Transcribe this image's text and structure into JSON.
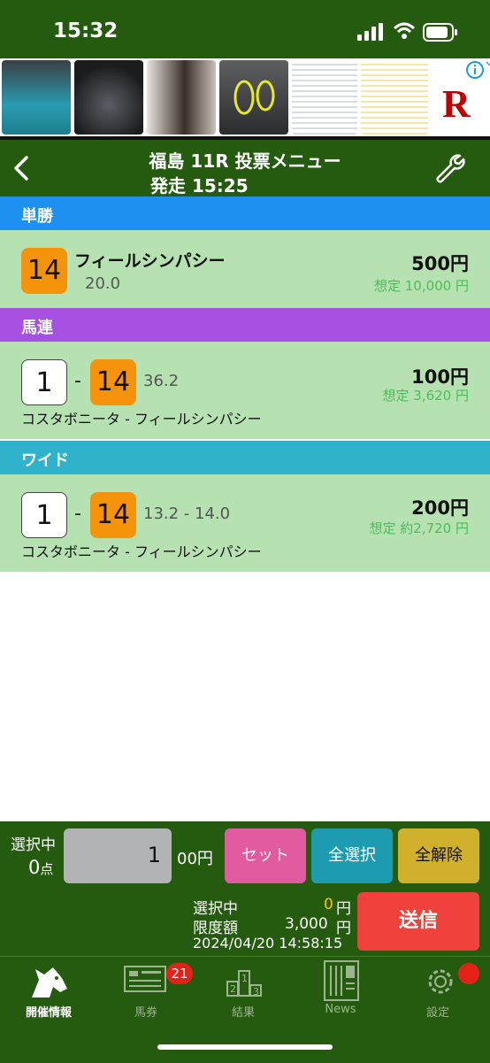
{
  "status": {
    "time": "15:32"
  },
  "ad": {
    "brand_letter": "R"
  },
  "header": {
    "title": "福島 11R 投票メニュー",
    "start": "発走 15:25"
  },
  "sections": [
    {
      "type": "単勝",
      "color": "#1e90f0",
      "bet": {
        "num": "14",
        "horse": "フィールシンパシー",
        "odds": "20.0",
        "amount": "500円",
        "estimate": "想定 10,000 円"
      }
    },
    {
      "type": "馬連",
      "color": "#a550e0",
      "bet": {
        "num1": "1",
        "num2": "14",
        "odds": "36.2",
        "names": "コスタボニータ - フィールシンパシー",
        "amount": "100円",
        "estimate": "想定 3,620 円"
      }
    },
    {
      "type": "ワイド",
      "color": "#2fb2cb",
      "bet": {
        "num1": "1",
        "num2": "14",
        "odds": "13.2 - 14.0",
        "names": "コスタボニータ - フィールシンパシー",
        "amount": "200円",
        "estimate": "想定 約2,720 円"
      }
    }
  ],
  "panel": {
    "sel_label": "選択中",
    "sel_count": "0",
    "sel_count_unit": "点",
    "unit_value": "1",
    "unit_suffix": "00円",
    "btn_set": "セット",
    "btn_select_all": "全選択",
    "btn_clear_all": "全解除",
    "selected_label": "選択中",
    "selected_value": "0",
    "selected_unit": "円",
    "limit_label": "限度額",
    "limit_value": "3,000",
    "limit_unit": "円",
    "datetime": "2024/04/20 14:58:15",
    "send": "送信"
  },
  "tabs": [
    {
      "label": "開催情報",
      "icon": "horse-head-icon",
      "active": true
    },
    {
      "label": "馬券",
      "icon": "ticket-icon",
      "badge": "21"
    },
    {
      "label": "結果",
      "icon": "podium-icon"
    },
    {
      "label": "News",
      "icon": "newspaper-icon"
    },
    {
      "label": "設定",
      "icon": "gear-icon"
    }
  ]
}
